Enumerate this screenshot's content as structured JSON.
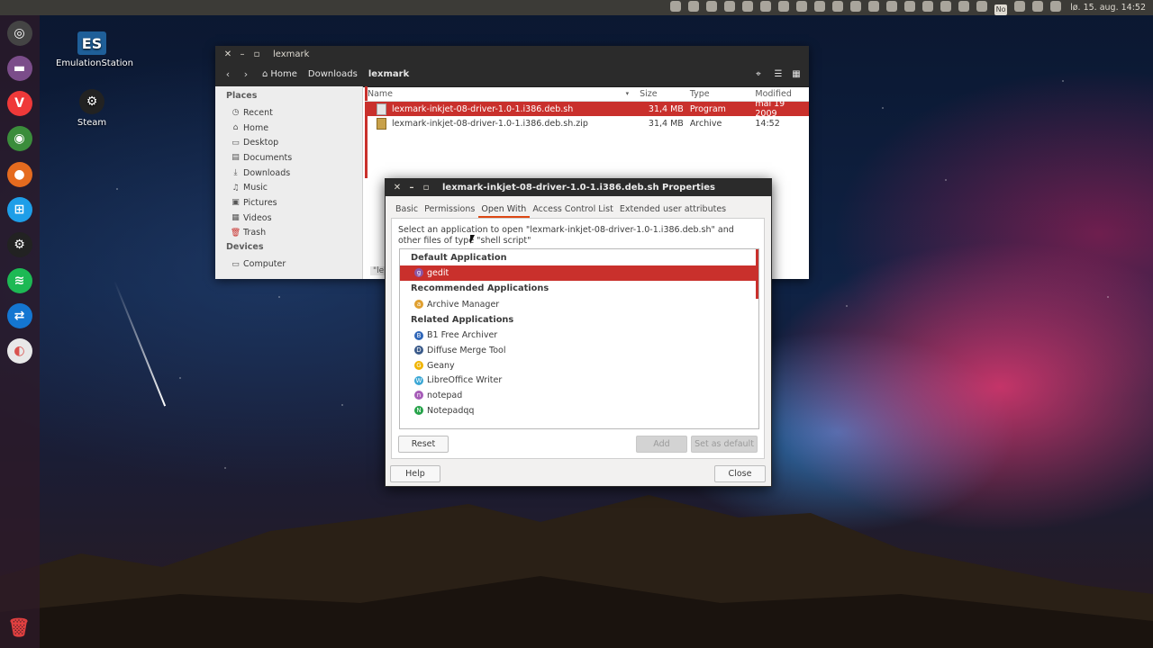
{
  "top_panel": {
    "icons": [
      "chrome-remote-icon",
      "sync-icon",
      "steam-icon",
      "spotify-icon",
      "teamviewer-icon",
      "screenshot-icon",
      "camera-icon",
      "chrome-icon",
      "notification-icon",
      "whatsapp-icon",
      "nvidia-icon",
      "app-icon",
      "clip-icon",
      "power-meter-icon",
      "grid-icon",
      "settings-icon",
      "battery-icon",
      "network-icon",
      "no-icon",
      "bluetooth-icon",
      "mail-icon",
      "volume-icon"
    ],
    "no_badge": "No",
    "clock": "lø. 15. aug. 14:52"
  },
  "launcher": [
    {
      "name": "ubuntu-dash-icon",
      "glyph": "◎",
      "color": "#444"
    },
    {
      "name": "files-icon",
      "glyph": "▬",
      "color": "#7b4d8a"
    },
    {
      "name": "vivaldi-icon",
      "glyph": "V",
      "color": "#ef3939"
    },
    {
      "name": "chrome-icon",
      "glyph": "◉",
      "color": "#3b8d3b"
    },
    {
      "name": "firefox-icon",
      "glyph": "●",
      "color": "#e56b1f"
    },
    {
      "name": "windows-icon",
      "glyph": "⊞",
      "color": "#1e9ee8"
    },
    {
      "name": "steam-icon",
      "glyph": "⚙",
      "color": "#222"
    },
    {
      "name": "spotify-icon",
      "glyph": "≋",
      "color": "#1db954"
    },
    {
      "name": "teamviewer-icon",
      "glyph": "⇄",
      "color": "#1476d1"
    },
    {
      "name": "disk-usage-icon",
      "glyph": "◐",
      "color": "#e8e8e8"
    }
  ],
  "desktop": {
    "icons": [
      {
        "label": "EmulationStation",
        "glyph": "ES"
      },
      {
        "label": "Steam",
        "glyph": "⚙"
      }
    ]
  },
  "files_window": {
    "title": "lexmark",
    "breadcrumbs": [
      "Home",
      "Downloads",
      "lexmark"
    ],
    "places_header": "Places",
    "places": [
      {
        "label": "Recent",
        "icon": "clock-icon",
        "glyph": "◷"
      },
      {
        "label": "Home",
        "icon": "home-icon",
        "glyph": "⌂"
      },
      {
        "label": "Desktop",
        "icon": "desktop-icon",
        "glyph": "▭"
      },
      {
        "label": "Documents",
        "icon": "documents-icon",
        "glyph": "▤"
      },
      {
        "label": "Downloads",
        "icon": "downloads-icon",
        "glyph": "⤓"
      },
      {
        "label": "Music",
        "icon": "music-icon",
        "glyph": "♫"
      },
      {
        "label": "Pictures",
        "icon": "pictures-icon",
        "glyph": "▣"
      },
      {
        "label": "Videos",
        "icon": "videos-icon",
        "glyph": "▦"
      },
      {
        "label": "Trash",
        "icon": "trash-icon",
        "glyph": "🗑"
      }
    ],
    "devices_header": "Devices",
    "devices": [
      {
        "label": "Computer",
        "icon": "computer-icon",
        "glyph": "▭"
      }
    ],
    "columns": [
      "Name",
      "Size",
      "Type",
      "Modified"
    ],
    "files": [
      {
        "name": "lexmark-inkjet-08-driver-1.0-1.i386.deb.sh",
        "size": "31,4 MB",
        "type": "Program",
        "modified": "mai 19 2009",
        "selected": true
      },
      {
        "name": "lexmark-inkjet-08-driver-1.0-1.i386.deb.sh.zip",
        "size": "31,4 MB",
        "type": "Archive",
        "modified": "14:52",
        "selected": false
      }
    ],
    "status_stub": "\"le"
  },
  "properties_dialog": {
    "title": "lexmark-inkjet-08-driver-1.0-1.i386.deb.sh Properties",
    "tabs": [
      "Basic",
      "Permissions",
      "Open With",
      "Access Control List",
      "Extended user attributes"
    ],
    "active_tab": "Open With",
    "description": "Select an application to open \"lexmark-inkjet-08-driver-1.0-1.i386.deb.sh\" and other files of type \"shell script\"",
    "default_header": "Default Application",
    "default_app": {
      "label": "gedit",
      "color": "#8b57a6",
      "glyph": "g"
    },
    "recommended_header": "Recommended Applications",
    "recommended": [
      {
        "label": "Archive Manager",
        "color": "#e0a030",
        "glyph": "a"
      }
    ],
    "related_header": "Related Applications",
    "related": [
      {
        "label": "B1 Free Archiver",
        "color": "#2f66b8",
        "glyph": "B"
      },
      {
        "label": "Diffuse Merge Tool",
        "color": "#3a5a8a",
        "glyph": "D"
      },
      {
        "label": "Geany",
        "color": "#f0b400",
        "glyph": "G"
      },
      {
        "label": "LibreOffice Writer",
        "color": "#3ba7d5",
        "glyph": "W"
      },
      {
        "label": "notepad",
        "color": "#a65cb8",
        "glyph": "n"
      },
      {
        "label": "Notepadqq",
        "color": "#27a34a",
        "glyph": "N"
      }
    ],
    "buttons": {
      "reset": "Reset",
      "add": "Add",
      "set_default": "Set as default",
      "help": "Help",
      "close": "Close"
    }
  }
}
